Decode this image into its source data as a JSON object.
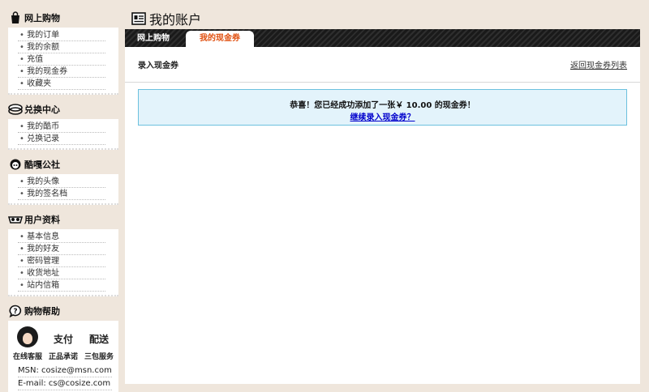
{
  "sidebar": {
    "sections": [
      {
        "title": "网上购物",
        "icon": "shopping-bag-icon",
        "items": [
          "我的订单",
          "我的余额",
          "充值",
          "我的现金券",
          "收藏夹"
        ]
      },
      {
        "title": "兑换中心",
        "icon": "coins-icon",
        "items": [
          "我的酷币",
          "兑换记录"
        ]
      },
      {
        "title": "酷嘎公社",
        "icon": "character-icon",
        "items": [
          "我的头像",
          "我的签名档"
        ]
      },
      {
        "title": "用户资料",
        "icon": "glasses-icon",
        "items": [
          "基本信息",
          "我的好友",
          "密码管理",
          "收货地址",
          "站内信箱"
        ]
      }
    ],
    "help": {
      "title": "购物帮助",
      "icon": "speech-bubble-icon",
      "col1_small": "在线客服",
      "col2_big": "支付",
      "col2_small": "正品承诺",
      "col3_big": "配送",
      "col3_small": "三包服务",
      "msn": "MSN: cosize@msn.com",
      "email": "E-mail: cs@cosize.com"
    }
  },
  "header": {
    "title": "我的账户",
    "icon": "account-card-icon"
  },
  "tabs": {
    "online": "网上购物",
    "cash": "我的现金券"
  },
  "main": {
    "sub_title": "录入现金券",
    "back_link": "返回现金券列表",
    "notice_msg": "恭喜！您已经成功添加了一张￥ 10.00 的现金券！",
    "notice_link": "继续录入现金券？"
  },
  "colors": {
    "accent": "#e05010",
    "notice_bg": "#e3f3fb",
    "notice_border": "#6cc1de",
    "page_bg": "#efe6dc"
  }
}
